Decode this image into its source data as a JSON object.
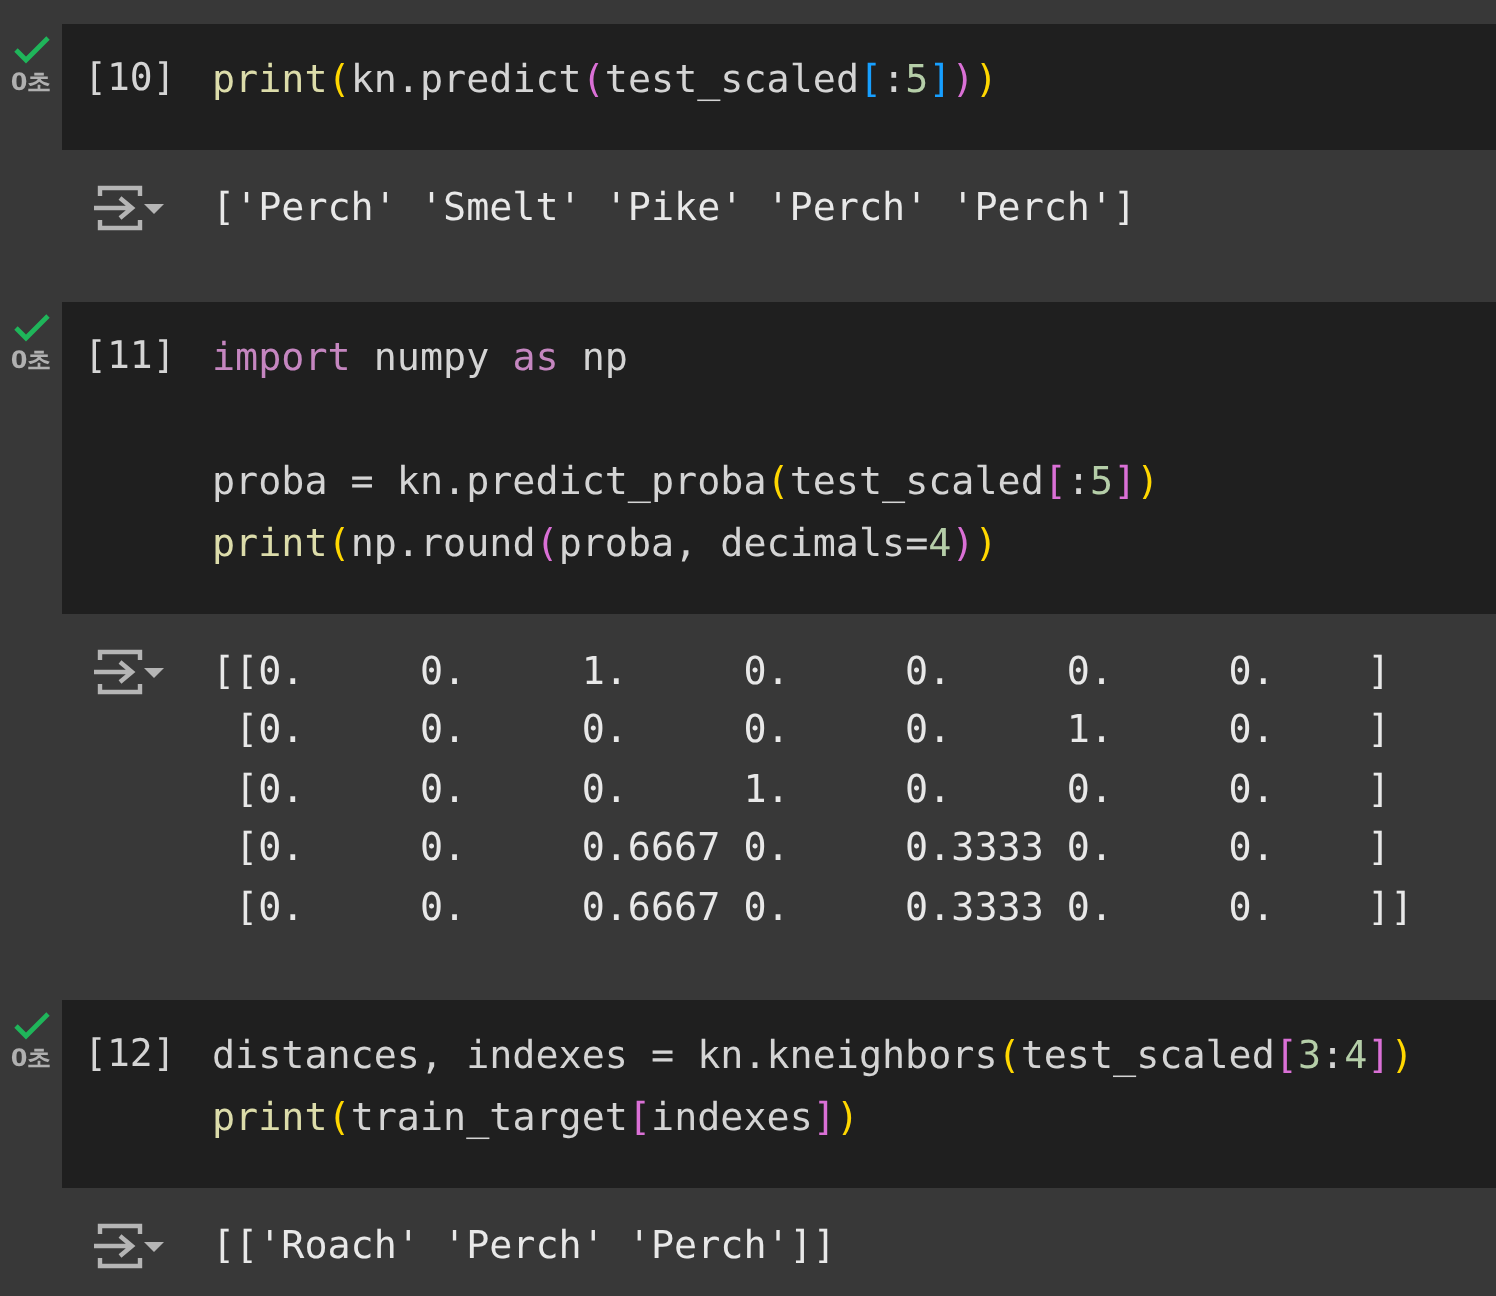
{
  "cells": [
    {
      "status_ok": true,
      "time": "0초",
      "prompt": "[10]",
      "code": [
        {
          "kind": "code",
          "tokens": [
            {
              "text": "print",
              "kind": "func"
            },
            {
              "text": "(",
              "kind": "paren1"
            },
            {
              "text": "kn.predict",
              "kind": "plain"
            },
            {
              "text": "(",
              "kind": "paren2"
            },
            {
              "text": "test_scaled",
              "kind": "plain"
            },
            {
              "text": "[",
              "kind": "paren3"
            },
            {
              "text": ":",
              "kind": "plain"
            },
            {
              "text": "5",
              "kind": "number"
            },
            {
              "text": "]",
              "kind": "paren3"
            },
            {
              "text": ")",
              "kind": "paren2"
            },
            {
              "text": ")",
              "kind": "paren1"
            }
          ]
        }
      ],
      "output": [
        "['Perch' 'Smelt' 'Pike' 'Perch' 'Perch']"
      ]
    },
    {
      "status_ok": true,
      "time": "0초",
      "prompt": "[11]",
      "code": [
        {
          "kind": "code",
          "tokens": [
            {
              "text": "import",
              "kind": "keyword"
            },
            {
              "text": " numpy ",
              "kind": "plain"
            },
            {
              "text": "as",
              "kind": "keyword"
            },
            {
              "text": " np",
              "kind": "plain"
            }
          ]
        },
        {
          "kind": "blank"
        },
        {
          "kind": "code",
          "tokens": [
            {
              "text": "proba = kn.predict_proba",
              "kind": "plain"
            },
            {
              "text": "(",
              "kind": "paren1"
            },
            {
              "text": "test_scaled",
              "kind": "plain"
            },
            {
              "text": "[",
              "kind": "paren2"
            },
            {
              "text": ":",
              "kind": "plain"
            },
            {
              "text": "5",
              "kind": "number"
            },
            {
              "text": "]",
              "kind": "paren2"
            },
            {
              "text": ")",
              "kind": "paren1"
            }
          ]
        },
        {
          "kind": "code",
          "tokens": [
            {
              "text": "print",
              "kind": "func"
            },
            {
              "text": "(",
              "kind": "paren1"
            },
            {
              "text": "np.round",
              "kind": "plain"
            },
            {
              "text": "(",
              "kind": "paren2"
            },
            {
              "text": "proba, decimals=",
              "kind": "plain"
            },
            {
              "text": "4",
              "kind": "number"
            },
            {
              "text": ")",
              "kind": "paren2"
            },
            {
              "text": ")",
              "kind": "paren1"
            }
          ]
        }
      ],
      "output": [
        "[[0.     0.     1.     0.     0.     0.     0.    ]",
        " [0.     0.     0.     0.     0.     1.     0.    ]",
        " [0.     0.     0.     1.     0.     0.     0.    ]",
        " [0.     0.     0.6667 0.     0.3333 0.     0.    ]",
        " [0.     0.     0.6667 0.     0.3333 0.     0.    ]]"
      ]
    },
    {
      "status_ok": true,
      "time": "0초",
      "prompt": "[12]",
      "code": [
        {
          "kind": "code",
          "tokens": [
            {
              "text": "distances, indexes = kn.kneighbors",
              "kind": "plain"
            },
            {
              "text": "(",
              "kind": "paren1"
            },
            {
              "text": "test_scaled",
              "kind": "plain"
            },
            {
              "text": "[",
              "kind": "paren2"
            },
            {
              "text": "3",
              "kind": "number"
            },
            {
              "text": ":",
              "kind": "plain"
            },
            {
              "text": "4",
              "kind": "number"
            },
            {
              "text": "]",
              "kind": "paren2"
            },
            {
              "text": ")",
              "kind": "paren1"
            }
          ]
        },
        {
          "kind": "code",
          "tokens": [
            {
              "text": "print",
              "kind": "func"
            },
            {
              "text": "(",
              "kind": "paren1"
            },
            {
              "text": "train_target",
              "kind": "plain"
            },
            {
              "text": "[",
              "kind": "paren2"
            },
            {
              "text": "indexes",
              "kind": "plain"
            },
            {
              "text": "]",
              "kind": "paren2"
            },
            {
              "text": ")",
              "kind": "paren1"
            }
          ]
        }
      ],
      "output": [
        "[['Roach' 'Perch' 'Perch']]"
      ]
    }
  ]
}
